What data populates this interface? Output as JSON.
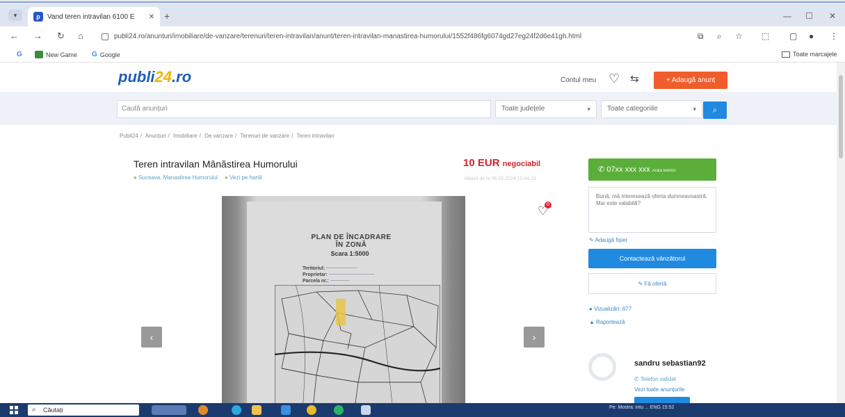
{
  "browser": {
    "tab_title": "Vand teren intravilan 6100 E",
    "tab_menu": "▾",
    "favicon_letter": "p",
    "url": "publi24.ro/anunturi/imobiliare/de-vanzare/terenuri/teren-intravilan/anunt/teren-intravilan-manastirea-humorului/1552f486fg6074gd27eg24f2d6e41gh.html",
    "bookmarks": [
      {
        "label": "New Game"
      },
      {
        "label": "Google"
      }
    ],
    "all_bookmarks_label": "Toate marcajele"
  },
  "site": {
    "logo_main": "publi",
    "logo_accent": "24",
    "logo_tld": ".ro",
    "account_label": "Contul meu",
    "add_ad_label": "+ Adaugă anunț",
    "search_placeholder": "Caută anunțuri",
    "county_select": "Toate județele",
    "category_select": "Toate categoriile",
    "breadcrumb": [
      "Publi24",
      "Anunțuri",
      "Imobiliare",
      "De vanzare",
      "Terenuri de vanzare",
      "Teren intravilan"
    ]
  },
  "listing": {
    "title": "Teren intravilan Mânăstirea Humorului",
    "price": "10 EUR",
    "price_note": "negociabil",
    "location": "Suceava, Manastirea Humorului",
    "map_link": "Vezi pe hartă",
    "validity": "Valabil de la 06.02.2024 12:44:13",
    "favorite_count": "0",
    "plan": {
      "title_line1": "PLAN DE ÎNCADRARE",
      "title_line2": "ÎN ZONĂ",
      "scale": "Scara 1:5000",
      "fields": [
        "Teritoriul:",
        "Proprietar:",
        "Parcela nr.:"
      ]
    }
  },
  "sidebar": {
    "phone_button": "07xx xxx xxx",
    "phone_hint": "Arată telefon",
    "message_text": "Bună, mă interesează oferta dumneavoastră. Mai este valabilă?",
    "attach_label": "Adaugă fișier",
    "send_label": "Contactează vânzătorul",
    "offer_label": "Fă ofertă",
    "views_label": "Vizualizări: 677",
    "report_label": "Raportează"
  },
  "seller": {
    "name": "sandru sebastian92",
    "verified_label": "Telefon validat",
    "all_ads_label": "Vezi toate anunțurile"
  },
  "taskbar": {
    "search_label": "Căutați",
    "tray_text": "Pe: Mostra: intu ... ENG 15:52"
  },
  "colors": {
    "brand_blue": "#1e5db8",
    "brand_yellow": "#f0b400",
    "add_button": "#f05c2c",
    "call_button": "#5cae3a",
    "primary": "#1f8ae0",
    "price_red": "#d2242a"
  }
}
